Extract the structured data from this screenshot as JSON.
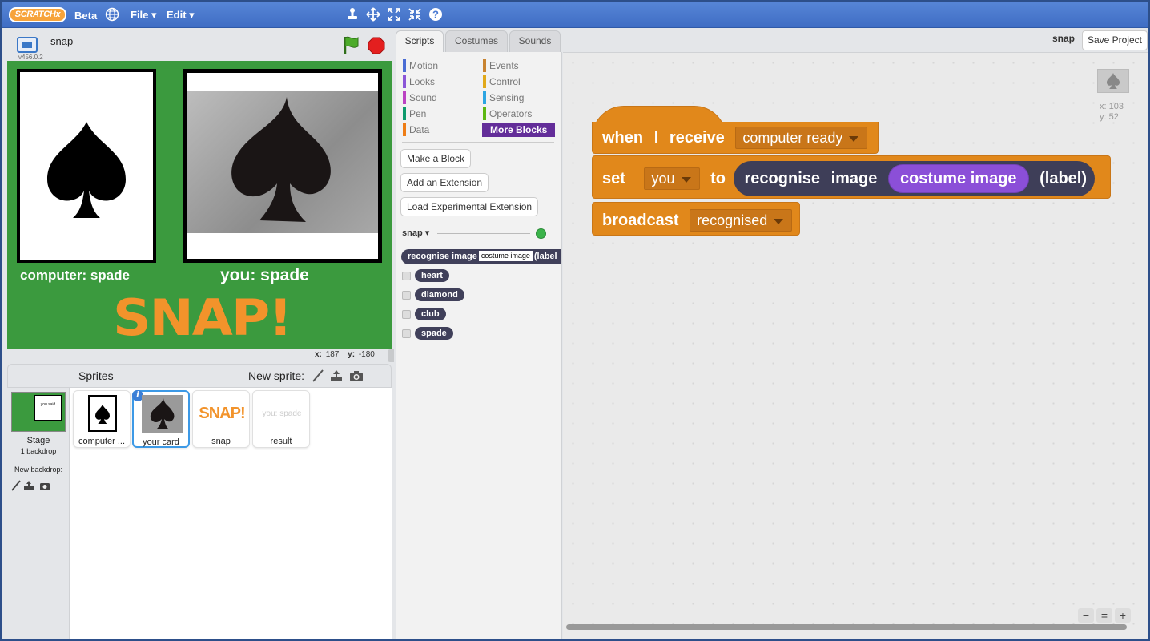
{
  "topbar": {
    "logo_text": "SCRATCHx",
    "beta": "Beta",
    "menus": {
      "file": "File ▾",
      "edit": "Edit ▾"
    },
    "tools": [
      "duplicate-stamp-icon",
      "cut-scissors-icon",
      "grow-icon",
      "shrink-icon",
      "help-icon"
    ]
  },
  "stage": {
    "project_name": "snap",
    "version": "v456.0.2",
    "computer_label": "computer:  spade",
    "you_label": "you: spade",
    "snap_text": "SNAP!",
    "coords": {
      "x_label": "x:",
      "x": "187",
      "y_label": "y:",
      "y": "-180"
    }
  },
  "sprite_corral": {
    "title": "Sprites",
    "new_sprite_label": "New sprite:",
    "stage": {
      "label": "Stage",
      "backdrops": "1 backdrop",
      "new_backdrop": "New backdrop:"
    },
    "sprites": [
      {
        "name": "computer ...",
        "selected": false
      },
      {
        "name": "your card",
        "selected": true
      },
      {
        "name": "snap",
        "selected": false
      },
      {
        "name": "result",
        "selected": false
      }
    ],
    "snap_thumb_text": "SNAP!",
    "result_thumb_text": "you: spade",
    "stage_thumb_text": "you said"
  },
  "tabs": {
    "scripts": "Scripts",
    "costumes": "Costumes",
    "sounds": "Sounds"
  },
  "palette": {
    "categories": [
      {
        "label": "Motion",
        "color": "#4a6cd4"
      },
      {
        "label": "Events",
        "color": "#c88330"
      },
      {
        "label": "Looks",
        "color": "#8a55d7"
      },
      {
        "label": "Control",
        "color": "#e1a91a"
      },
      {
        "label": "Sound",
        "color": "#bb42c3"
      },
      {
        "label": "Sensing",
        "color": "#2ca5e2"
      },
      {
        "label": "Pen",
        "color": "#0e9a6c"
      },
      {
        "label": "Operators",
        "color": "#5cb712"
      },
      {
        "label": "Data",
        "color": "#ee7d16"
      },
      {
        "label": "More Blocks",
        "color": "#632d99"
      }
    ],
    "buttons": {
      "make_block": "Make a Block",
      "add_extension": "Add an Extension",
      "load_experimental": "Load Experimental Extension"
    },
    "extension": {
      "name": "snap ▾",
      "status_color": "#3bb34a"
    },
    "block": {
      "prefix": "recognise  image",
      "slot": "costume image",
      "suffix": "(label"
    },
    "reporters": [
      "heart",
      "diamond",
      "club",
      "spade"
    ]
  },
  "scripts_area": {
    "sprite_name": "snap",
    "save_button": "Save Project",
    "sprite_x": "x: 103",
    "sprite_y": "y: 52",
    "hat": {
      "word1": "when",
      "word2": "I",
      "word3": "receive",
      "message": "computer ready"
    },
    "set": {
      "word": "set",
      "variable": "you",
      "to": "to",
      "recog1": "recognise",
      "recog2": "image",
      "costume": "costume image",
      "label": "(label)"
    },
    "broadcast": {
      "word": "broadcast",
      "message": "recognised"
    },
    "zoom": {
      "out": "−",
      "reset": "=",
      "in": "+"
    }
  }
}
